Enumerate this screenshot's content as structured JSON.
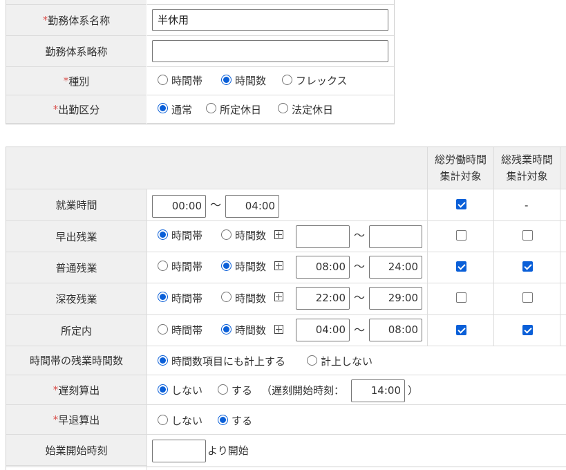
{
  "form1": {
    "name_label": "勤務体系名称",
    "name_value": "半休用",
    "short_label": "勤務体系略称",
    "short_value": "",
    "type_label": "種別",
    "type_options": [
      "時間帯",
      "時間数",
      "フレックス"
    ],
    "type_selected": "時間数",
    "attend_label": "出勤区分",
    "attend_options": [
      "通常",
      "所定休日",
      "法定休日"
    ],
    "attend_selected": "通常",
    "required_mark": "*"
  },
  "form2": {
    "col_total_work": "総労働時間",
    "col_total_work_sub": "集計対象",
    "col_total_ot": "総残業時間",
    "col_total_ot_sub": "集計対象",
    "dash": "-",
    "tilde": "〜",
    "opt_band": "時間帯",
    "opt_hours": "時間数",
    "work_hours": {
      "label": "就業時間",
      "from": "00:00",
      "to": "04:00",
      "total_work": true
    },
    "rows": [
      {
        "label": "早出残業",
        "mode": "時間帯",
        "from": "",
        "to": "",
        "total_work": false,
        "total_ot": false
      },
      {
        "label": "普通残業",
        "mode": "時間数",
        "from": "08:00",
        "to": "24:00",
        "total_work": true,
        "total_ot": true
      },
      {
        "label": "深夜残業",
        "mode": "時間帯",
        "from": "22:00",
        "to": "29:00",
        "total_work": false,
        "total_ot": false
      },
      {
        "label": "所定内",
        "mode": "時間数",
        "from": "04:00",
        "to": "08:00",
        "total_work": true,
        "total_ot": true
      }
    ],
    "band_ot": {
      "label": "時間帯の残業時間数",
      "opt_include": "時間数項目にも計上する",
      "opt_exclude": "計上しない",
      "selected": "時間数項目にも計上する"
    },
    "late": {
      "label": "遅刻算出",
      "opt_no": "しない",
      "opt_yes": "する",
      "selected": "しない",
      "start_label": "（遅刻開始時刻：",
      "start_value": "14:00",
      "close_paren": "）"
    },
    "early": {
      "label": "早退算出",
      "opt_no": "しない",
      "opt_yes": "する",
      "selected": "する"
    },
    "start_time": {
      "label": "始業開始時刻",
      "value": "",
      "suffix": "より開始"
    }
  }
}
